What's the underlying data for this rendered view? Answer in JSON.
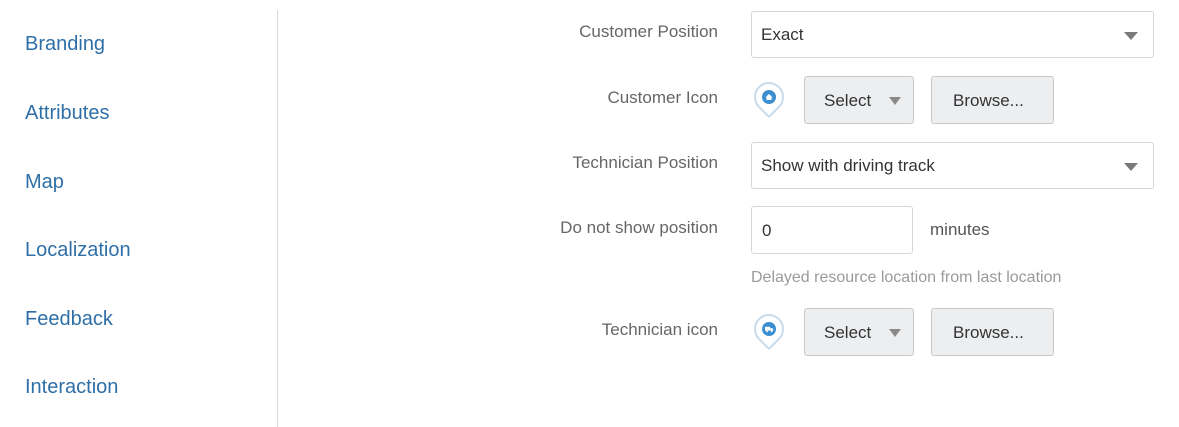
{
  "sidebar": {
    "items": [
      {
        "label": "Branding"
      },
      {
        "label": "Attributes"
      },
      {
        "label": "Map"
      },
      {
        "label": "Localization"
      },
      {
        "label": "Feedback"
      },
      {
        "label": "Interaction"
      }
    ]
  },
  "form": {
    "customer_position": {
      "label": "Customer Position",
      "value": "Exact"
    },
    "customer_icon": {
      "label": "Customer Icon",
      "icon": "home-pin-icon",
      "select_label": "Select",
      "browse_label": "Browse..."
    },
    "technician_position": {
      "label": "Technician Position",
      "value": "Show with driving track"
    },
    "do_not_show_position": {
      "label": "Do not show position",
      "value": "0",
      "units": "minutes",
      "hint": "Delayed resource location from last location"
    },
    "technician_icon": {
      "label": "Technician icon",
      "icon": "truck-pin-icon",
      "select_label": "Select",
      "browse_label": "Browse..."
    }
  },
  "colors": {
    "link": "#2f6fa7",
    "icon_accent": "#3b8fd0"
  }
}
